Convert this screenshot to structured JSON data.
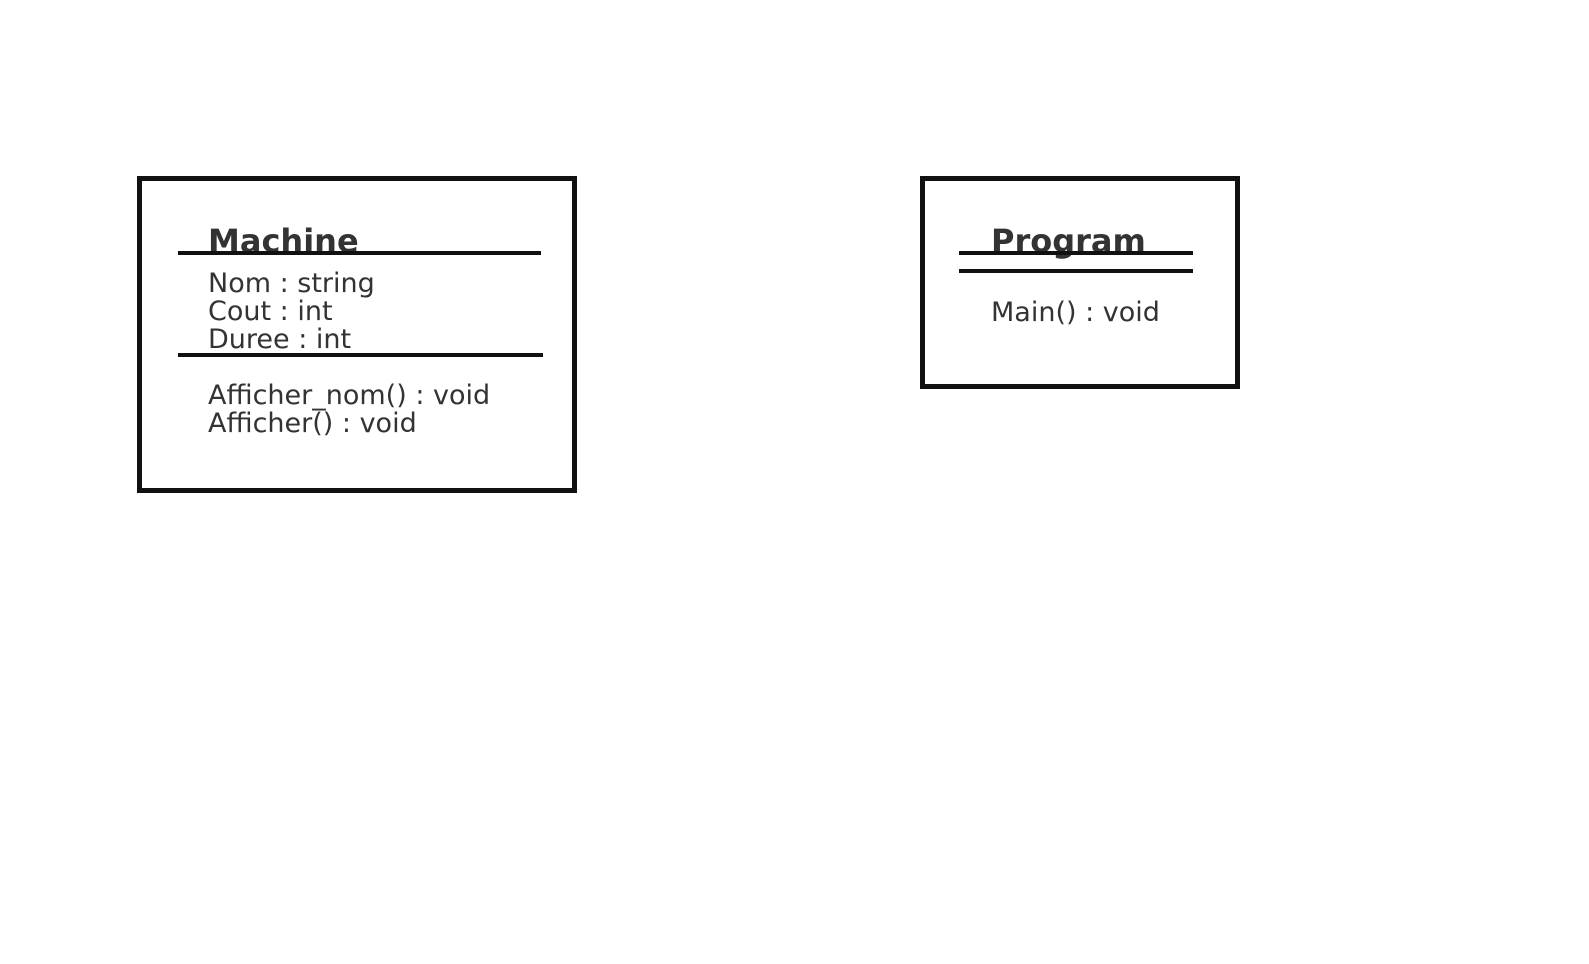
{
  "diagram": {
    "classes": [
      {
        "name": "Machine",
        "attributes": [
          "Nom : string",
          "Cout : int",
          "Duree : int"
        ],
        "methods": [
          "Afficher_nom() : void",
          "Afficher() : void"
        ]
      },
      {
        "name": "Program",
        "attributes": [],
        "methods": [
          "Main() : void"
        ]
      }
    ]
  }
}
